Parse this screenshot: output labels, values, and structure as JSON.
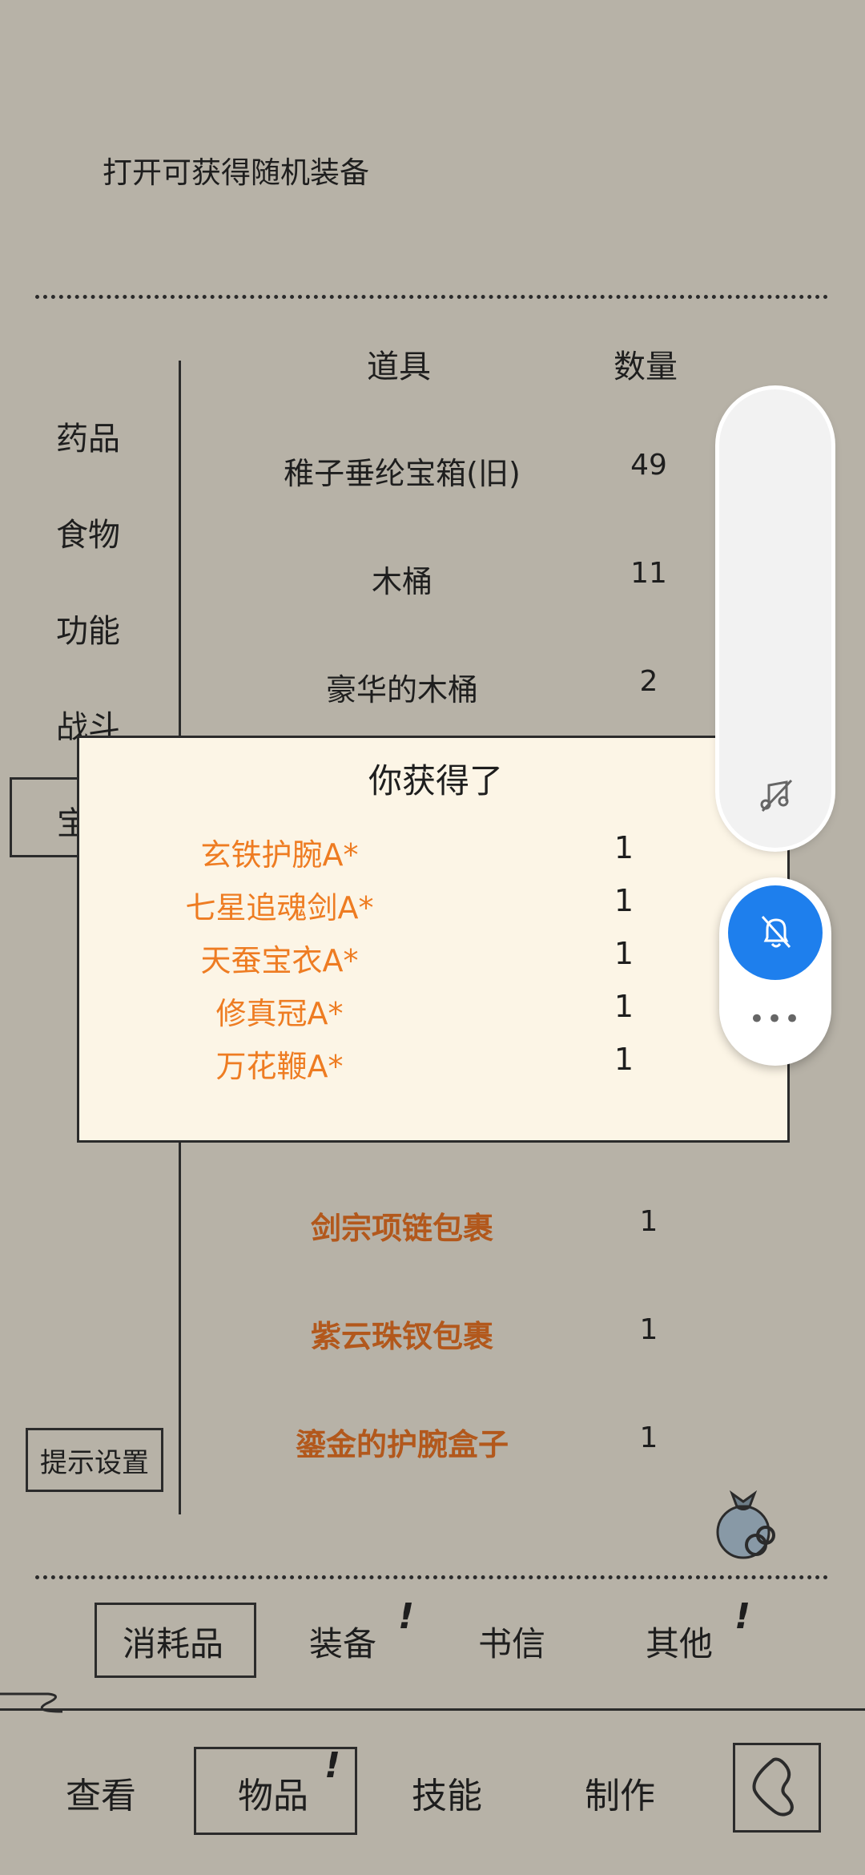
{
  "description": "打开可获得随机装备",
  "categories": [
    "药品",
    "食物",
    "功能",
    "战斗",
    "宝"
  ],
  "table": {
    "header_item": "道具",
    "header_qty": "数量",
    "rows_top": [
      {
        "name": "稚子垂纶宝箱(旧)",
        "qty": "49"
      },
      {
        "name": "木桶",
        "qty": "11"
      },
      {
        "name": "豪华的木桶",
        "qty": "2"
      }
    ],
    "rows_bottom": [
      {
        "name": "剑宗项链包裹",
        "qty": "1"
      },
      {
        "name": "紫云珠钗包裹",
        "qty": "1"
      },
      {
        "name": "鎏金的护腕盒子",
        "qty": "1"
      }
    ]
  },
  "hint_button": "提示设置",
  "popup": {
    "title": "你获得了",
    "rewards": [
      {
        "name": "玄铁护腕A*",
        "qty": "1"
      },
      {
        "name": "七星追魂剑A*",
        "qty": "1"
      },
      {
        "name": "天蚕宝衣A*",
        "qty": "1"
      },
      {
        "name": "修真冠A*",
        "qty": "1"
      },
      {
        "name": "万花鞭A*",
        "qty": "1"
      }
    ]
  },
  "sub_tabs": [
    "消耗品",
    "装备",
    "书信",
    "其他"
  ],
  "main_tabs": [
    "查看",
    "物品",
    "技能",
    "制作"
  ],
  "floating_widget": {
    "more": "•••"
  },
  "colors": {
    "background": "#b7b2a7",
    "popup_bg": "#fcf5e6",
    "reward_text": "#ee7c22",
    "item_brown": "#b2581c",
    "widget_accent": "#1e7fed"
  },
  "icons": [
    "music-off-icon",
    "bell-off-icon",
    "more-icon",
    "loot-bag-icon",
    "back-icon"
  ]
}
